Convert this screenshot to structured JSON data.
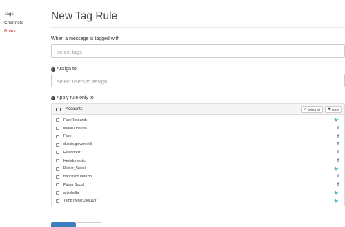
{
  "sidebar": {
    "items": [
      {
        "label": "Tags"
      },
      {
        "label": "Channels"
      },
      {
        "label": "Rules"
      }
    ]
  },
  "page": {
    "title": "New Tag Rule"
  },
  "form": {
    "tags_label": "When a message is tagged with",
    "tags_placeholder": "select tags",
    "assign_label": "Assign to",
    "assign_placeholder": "select users to assign",
    "apply_label": "Apply rule only to"
  },
  "accounts": {
    "header": "Accounts",
    "select_all": "select all",
    "none": "none",
    "rows": [
      {
        "name": "FaceResearch",
        "network": "twitter",
        "glyph": "🐦"
      },
      {
        "name": "lindaliu.maruta",
        "network": "facebook",
        "glyph": "f"
      },
      {
        "name": "Face",
        "network": "facebook",
        "glyph": "f"
      },
      {
        "name": "duccio.giovannelli",
        "network": "facebook",
        "glyph": "f"
      },
      {
        "name": "Extendtest",
        "network": "facebook",
        "glyph": "f"
      },
      {
        "name": "Herbdomestic",
        "network": "facebook",
        "glyph": "f"
      },
      {
        "name": "Pulsar_Social",
        "network": "twitter",
        "glyph": "🐦"
      },
      {
        "name": "francesco.dorazio",
        "network": "facebook",
        "glyph": "f"
      },
      {
        "name": "Pulsar Social",
        "network": "facebook",
        "glyph": "f"
      },
      {
        "name": "ariesbella",
        "network": "twitter",
        "glyph": "🐦"
      },
      {
        "name": "TempTwitterUser1197",
        "network": "twitter",
        "glyph": "🐦"
      }
    ]
  },
  "colors": {
    "active_nav": "#c0392b",
    "primary_button": "#3d7fc0",
    "twitter": "#3aa8d8",
    "facebook": "#3b5998"
  }
}
